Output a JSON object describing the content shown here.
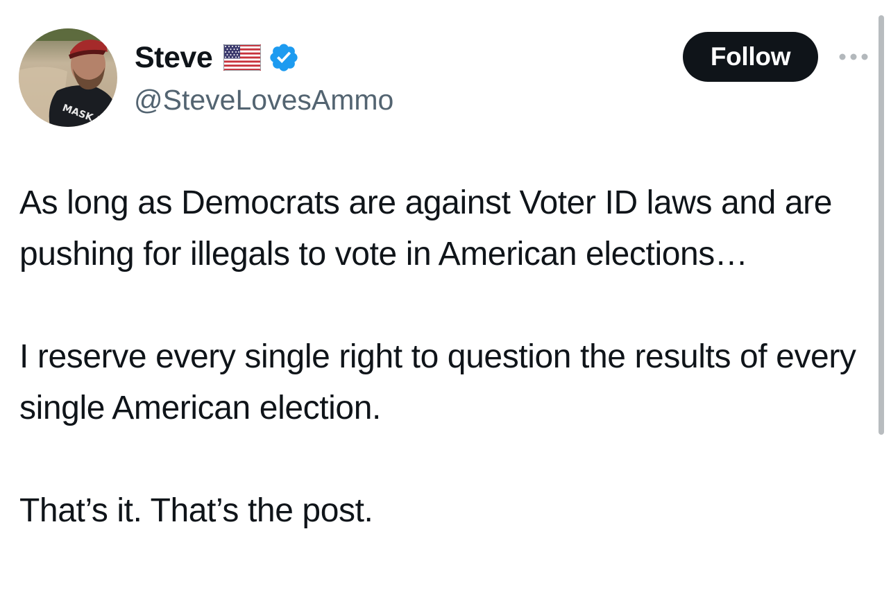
{
  "author": {
    "display_name": "Steve",
    "handle": "@SteveLovesAmmo",
    "name_emoji_icon": "us-flag-icon",
    "badge_icon": "verified-badge-icon",
    "avatar_shirt_text": "MASK FREE"
  },
  "actions": {
    "follow_label": "Follow",
    "more_icon": "more-options-icon"
  },
  "post": {
    "paragraphs": [
      "As long as Democrats are against Voter ID laws and are pushing for illegals to vote in American elections…",
      "I reserve every single right to question the results of every single American election.",
      "That’s it. That’s the post."
    ]
  },
  "colors": {
    "text_primary": "#0f1419",
    "text_secondary": "#536471",
    "follow_bg": "#0f1419",
    "verified_blue": "#1d9bf0"
  }
}
